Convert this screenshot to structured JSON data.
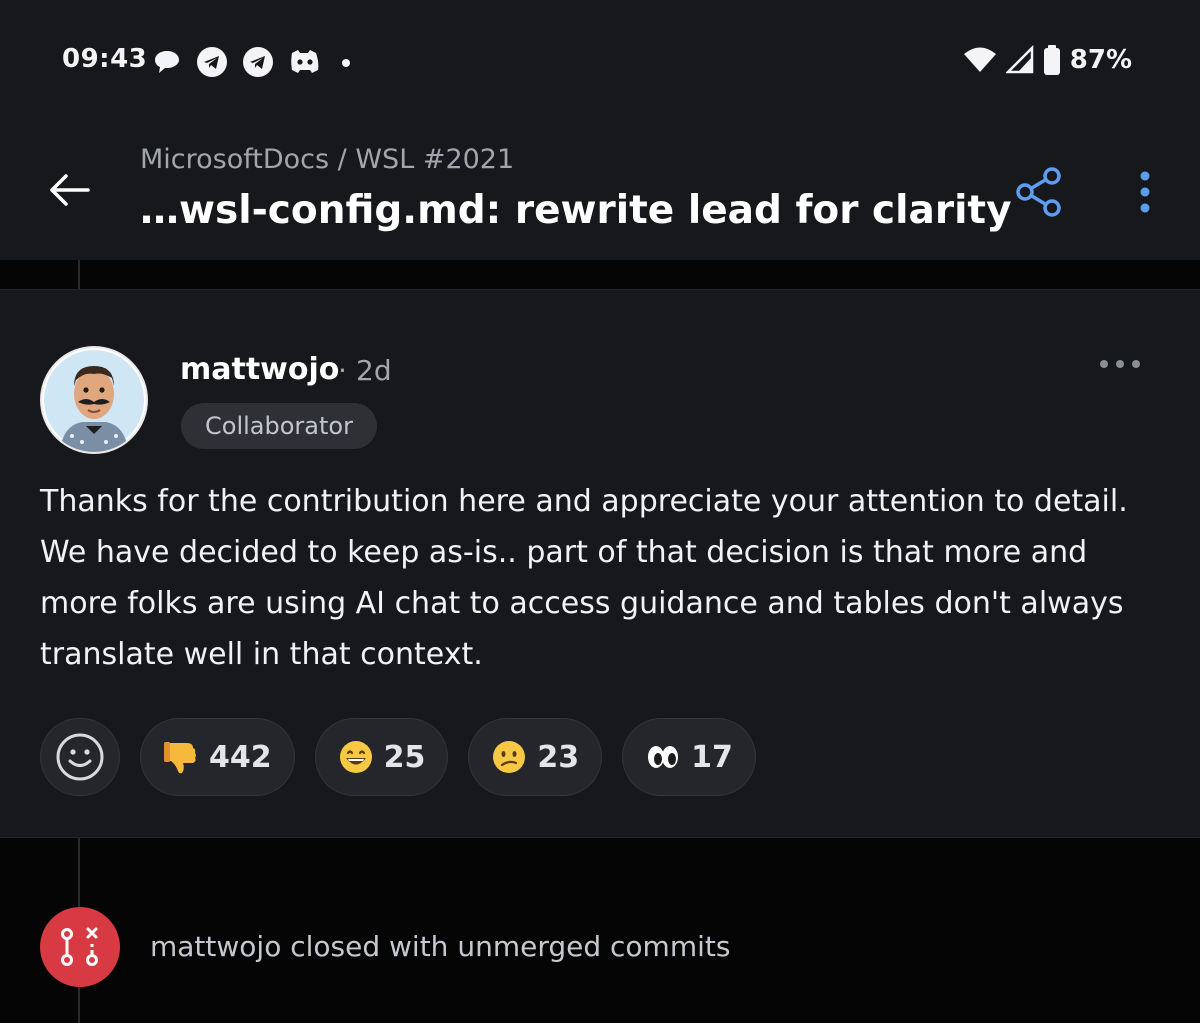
{
  "status_bar": {
    "time": "09:43",
    "battery_percent": "87%",
    "notification_icons": [
      "chat-bubble-icon",
      "telegram-icon",
      "telegram-icon",
      "discord-icon",
      "dot-icon"
    ],
    "system_icons": [
      "wifi-icon",
      "signal-icon",
      "battery-icon"
    ]
  },
  "app_bar": {
    "breadcrumb": "MicrosoftDocs / WSL #2021",
    "title": "…wsl-config.md: rewrite lead for clarity",
    "accent_color": "#5d9ef2"
  },
  "comment": {
    "author": "mattwojo",
    "separator": "·",
    "time_ago": "2d",
    "role_badge": "Collaborator",
    "body": "Thanks for the contribution here and appreciate your attention to detail. We have decided to keep as-is.. part of that decision is that more and more folks are using AI chat to access guidance and tables don't always translate well in that context.",
    "reactions": [
      {
        "emoji": "thumbs-down",
        "count": "442"
      },
      {
        "emoji": "grinning-face",
        "count": "25"
      },
      {
        "emoji": "confused-face",
        "count": "23"
      },
      {
        "emoji": "eyes",
        "count": "17"
      }
    ]
  },
  "event": {
    "text": "mattwojo closed with unmerged commits",
    "badge_color": "#d83a43"
  }
}
